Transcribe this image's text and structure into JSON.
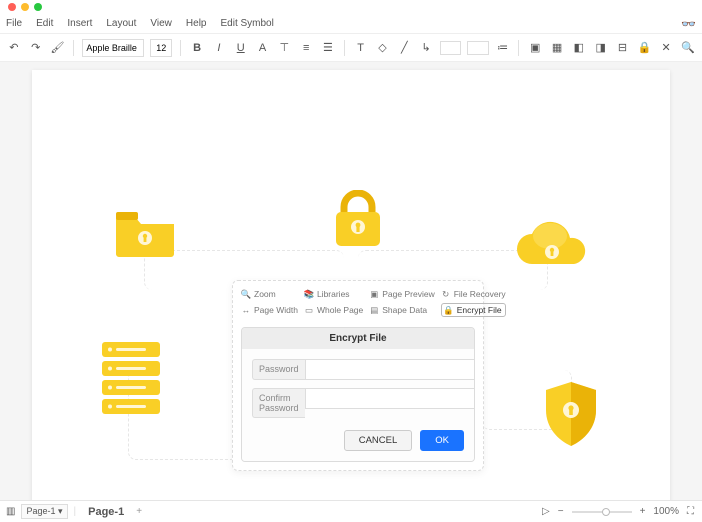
{
  "menubar": [
    "File",
    "Edit",
    "Insert",
    "Layout",
    "View",
    "Help",
    "Edit Symbol"
  ],
  "toolbar": {
    "font": "Apple Braille",
    "size": "12"
  },
  "panel": {
    "items": [
      {
        "icon": "zoom",
        "label": "Zoom"
      },
      {
        "icon": "libraries",
        "label": "Libraries"
      },
      {
        "icon": "page-preview",
        "label": "Page Preview"
      },
      {
        "icon": "file-recovery",
        "label": "File Recovery"
      },
      {
        "icon": "page-width",
        "label": "Page Width"
      },
      {
        "icon": "whole-page",
        "label": "Whole Page"
      },
      {
        "icon": "shape-data",
        "label": "Shape Data"
      },
      {
        "icon": "encrypt",
        "label": "Encrypt File"
      }
    ]
  },
  "dialog": {
    "title": "Encrypt File",
    "password_label": "Password",
    "confirm_label": "Confirm Password",
    "cancel": "CANCEL",
    "ok": "OK"
  },
  "status": {
    "page_select": "Page-1",
    "tab": "Page-1",
    "zoom": "100%"
  },
  "colors": {
    "yellow_main": "#f9cf26",
    "yellow_dark": "#eab308",
    "blue": "#1a73ff"
  }
}
